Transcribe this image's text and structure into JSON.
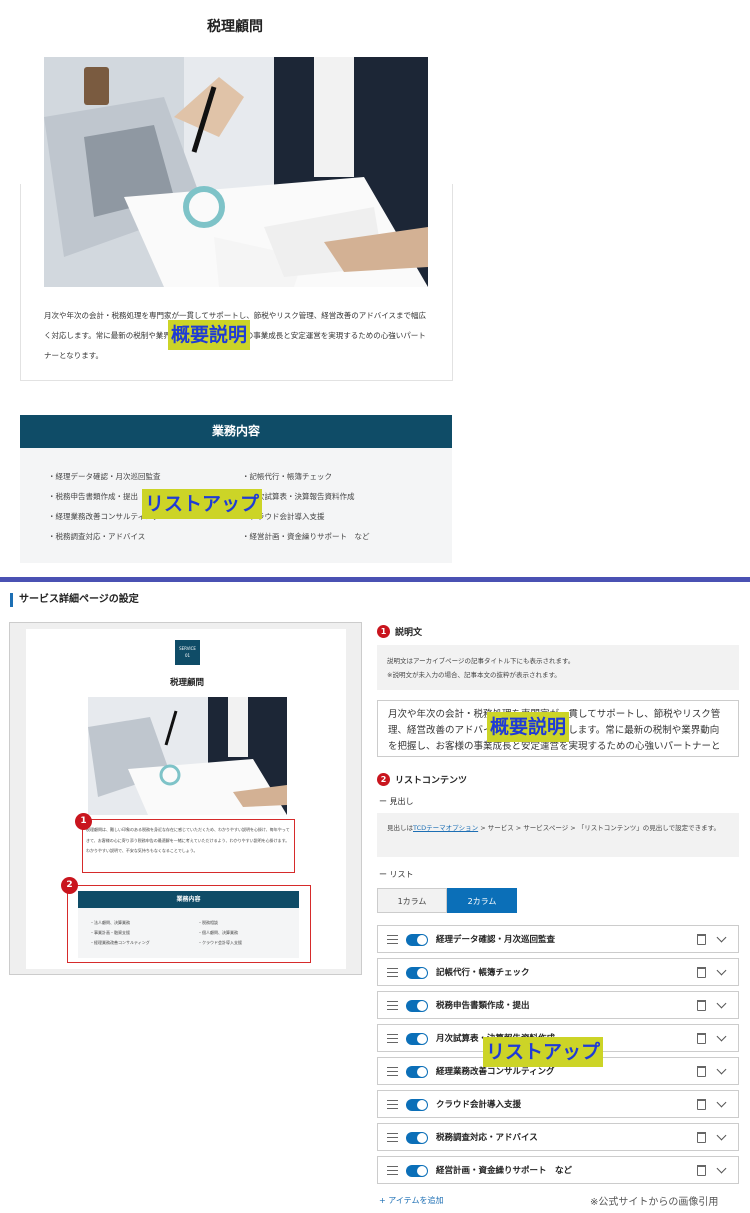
{
  "top": {
    "title": "税理顧問",
    "description": "月次や年次の会計・税務処理を専門家が一貫してサポートし、節税やリスク管理、経営改善のアドバイスまで幅広く対応します。常に最新の税制や業界動向を把握し、お客様の事業成長と安定運営を実現するための心強いパートナーとなります。",
    "label_overview": "概要説明",
    "label_list": "リストアップ",
    "services_heading": "業務内容",
    "services": [
      "・経理データ確認・月次巡回監査",
      "・記帳代行・帳簿チェック",
      "・税務申告書類作成・提出",
      "・月次試算表・決算報告資料作成",
      "・経理業務改善コンサルティング",
      "・クラウド会計導入支援",
      "・税務調査対応・アドバイス",
      "・経営計画・資金繰りサポート　など"
    ]
  },
  "admin": {
    "section_title": "サービス詳細ページの設定",
    "preview": {
      "badge_line1": "SERVICE",
      "badge_line2": "01",
      "title": "税理顧問",
      "description": "税理顧問は、難しい印象のある税務を身近な存在に感じていただくため、わかりやすい説明を心掛け、毎年やってきて、お客様の心に寄り添う税務申告の最適解を一緒に考えていただけるよう、わかりやすい説明を心掛けます。わかりやすい説明で、不安な気持ちもなくなることでしょう。",
      "num1": "1",
      "num2": "2",
      "services_heading": "業務内容",
      "services": [
        "・法人顧問、決算業務",
        "・税務相談",
        "・事業計画・融資支援",
        "・個人顧問、決算業務",
        "・経理業務改善コンサルティング",
        "・クラウド会計導入支援"
      ]
    },
    "desc": {
      "num": "1",
      "label": "説明文",
      "note_line1": "説明文はアーカイブページの記事タイトル下にも表示されます。",
      "note_line2": "※説明文が未入力の場合、記事本文の抜粋が表示されます。",
      "textarea": "月次や年次の会計・税務処理を専門家が一貫してサポートし、節税やリスク管理、経営改善のアドバイスまで幅広く対応します。常に最新の税制や業界動向を把握し、お客様の事業成長と安定運営を実現するための心強いパートナーとなります。",
      "overlay": "概要説明"
    },
    "list": {
      "num": "2",
      "label": "リストコンテンツ",
      "heading_sub": "ー 見出し",
      "heading_note_pre": "見出しは",
      "heading_note_link": "TCDテーマオプション",
      "heading_note_post": " > サービス > サービスページ > 「リストコンテンツ」の見出しで設定できます。",
      "list_sub": "ー リスト",
      "tabs": [
        "1カラム",
        "2カラム"
      ],
      "items": [
        "経理データ確認・月次巡回監査",
        "記帳代行・帳簿チェック",
        "税務申告書類作成・提出",
        "月次試算表・決算報告資料作成",
        "経理業務改善コンサルティング",
        "クラウド会計導入支援",
        "税務調査対応・アドバイス",
        "経営計画・資金繰りサポート　など"
      ],
      "overlay": "リストアップ",
      "add_item": "+ アイテムを追加"
    },
    "credit": "※公式サイトからの画像引用"
  },
  "colors": {
    "navy": "#0f4c67",
    "accent_blue": "#0b6fb8",
    "highlight": "#ccd427",
    "highlight_text": "#1f3bd6",
    "marker_red": "#c9151e",
    "divider": "#4a51b3"
  }
}
